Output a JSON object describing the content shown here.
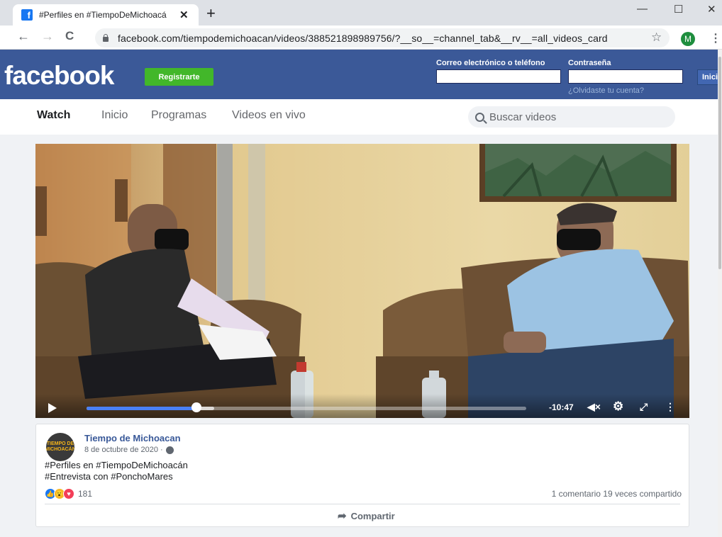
{
  "browser": {
    "tab_title": "#Perfiles en #TiempoDeMichoacá",
    "tab_favicon": "f",
    "new_tab": "+",
    "url": "facebook.com/tiempodemichoacan/videos/388521898989756/?__so__=channel_tab&__rv__=all_videos_card",
    "profile_initial": "M",
    "window_controls": {
      "minimize": "—",
      "maximize": "☐",
      "close": "✕"
    },
    "nav": {
      "back": "←",
      "forward": "→",
      "reload": "C",
      "star": "☆",
      "menu": "⋮"
    }
  },
  "fb_header": {
    "logo": "facebook",
    "register_label": "Registrarte",
    "email_label": "Correo electrónico o teléfono",
    "password_label": "Contraseña",
    "forgot_link": "¿Olvidaste tu cuenta?",
    "login_label": "Inici"
  },
  "watch_nav": {
    "items": [
      "Watch",
      "Inicio",
      "Programas",
      "Videos en vivo"
    ],
    "search_placeholder": "Buscar videos"
  },
  "video": {
    "time_remaining": "-10:47",
    "progress": 0.25,
    "buffered": 0.29
  },
  "post": {
    "page_name": "Tiempo de Michoacan",
    "avatar_text": "TIEMPO DE MICHOACÁN",
    "date": "8 de octubre de 2020 ·",
    "text_line1": "#Perfiles en #TiempoDeMichoacán",
    "text_line2": "#Entrevista con #PonchoMares",
    "reaction_count": "181",
    "stats": "1 comentario  19 veces compartido",
    "share_label": "Compartir"
  },
  "colors": {
    "fb_blue": "#3b5998",
    "register_green": "#42b72a",
    "progress_blue": "#4a80f5"
  }
}
